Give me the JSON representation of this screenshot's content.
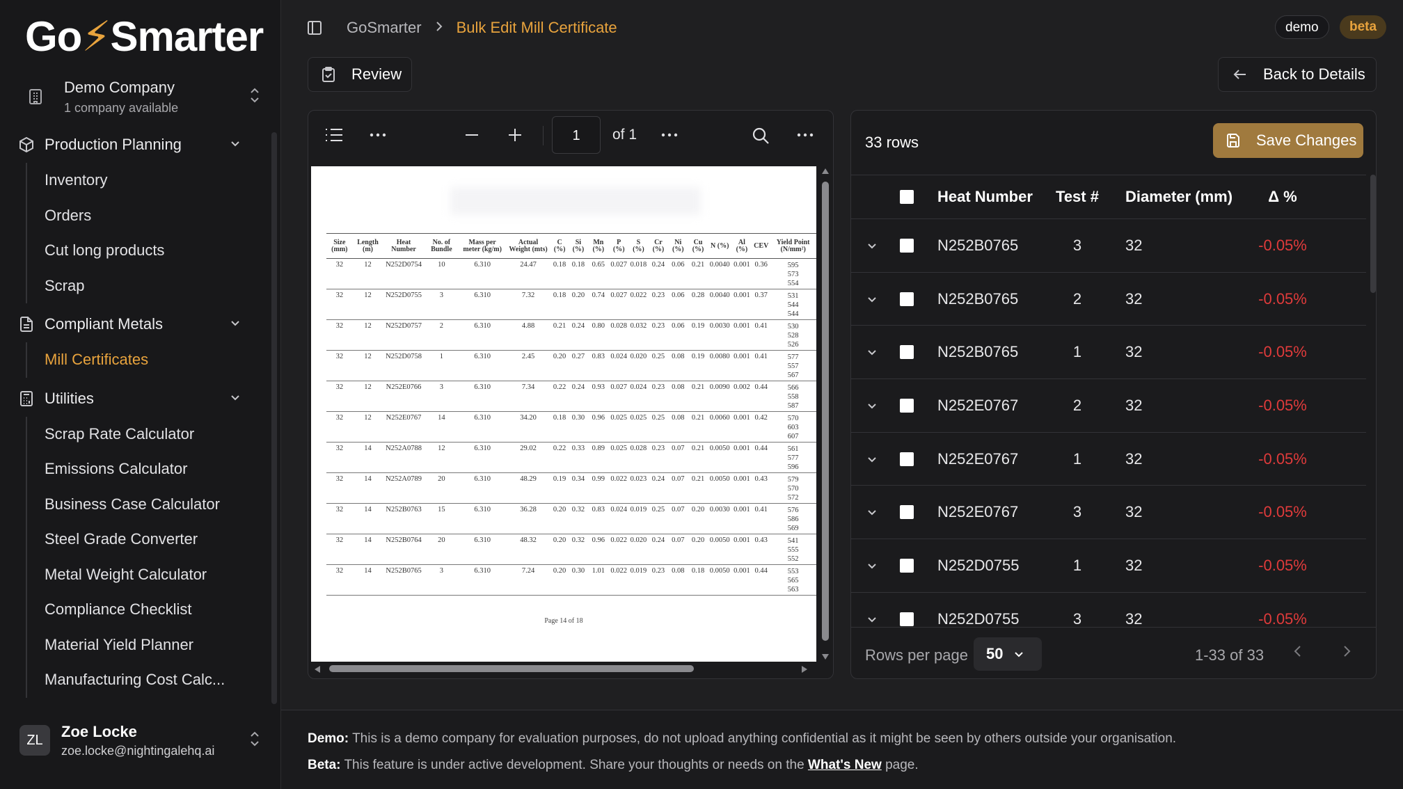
{
  "app": {
    "logo_text_a": "Go",
    "logo_text_b": "Smarter",
    "logo_full": "GoSmarter"
  },
  "company": {
    "name": "Demo Company",
    "sub": "1 company available"
  },
  "nav": [
    {
      "label": "Production Planning",
      "icon": "package-icon",
      "items": [
        "Inventory",
        "Orders",
        "Cut long products",
        "Scrap"
      ]
    },
    {
      "label": "Compliant Metals",
      "icon": "document-icon",
      "items": [
        "Mill Certificates"
      ]
    },
    {
      "label": "Utilities",
      "icon": "calculator-icon",
      "items": [
        "Scrap Rate Calculator",
        "Emissions Calculator",
        "Business Case Calculator",
        "Steel Grade Converter",
        "Metal Weight Calculator",
        "Compliance Checklist",
        "Material Yield Planner",
        "Manufacturing Cost Calc..."
      ]
    }
  ],
  "active_item": "Mill Certificates",
  "user": {
    "initials": "ZL",
    "name": "Zoe Locke",
    "email": "zoe.locke@nightingalehq.ai"
  },
  "breadcrumb": {
    "root": "GoSmarter",
    "current": "Bulk Edit Mill Certificate"
  },
  "badges": {
    "demo": "demo",
    "beta": "beta"
  },
  "buttons": {
    "review": "Review",
    "back": "Back to Details",
    "save": "Save Changes"
  },
  "viewer": {
    "page": "1",
    "of_pages": "of 1",
    "footer": "Page 14 of 18"
  },
  "certificate": {
    "headers": [
      "Size (mm)",
      "Length (m)",
      "Heat Number",
      "No. of Bundle",
      "Mass per meter (kg/m)",
      "Actual Weight (mts)",
      "C (%)",
      "Si (%)",
      "Mn (%)",
      "P (%)",
      "S (%)",
      "Cr (%)",
      "Ni (%)",
      "Cu (%)",
      "N (%)",
      "Al (%)",
      "CEV",
      "Yield Point (N/mm²)"
    ],
    "rows": [
      [
        "32",
        "12",
        "N252D0754",
        "10",
        "6.310",
        "24.47",
        "0.18",
        "0.18",
        "0.65",
        "0.027",
        "0.018",
        "0.24",
        "0.06",
        "0.21",
        "0.0040",
        "0.001",
        "0.36",
        "595\n573\n554"
      ],
      [
        "32",
        "12",
        "N252D0755",
        "3",
        "6.310",
        "7.32",
        "0.18",
        "0.20",
        "0.74",
        "0.027",
        "0.022",
        "0.23",
        "0.06",
        "0.28",
        "0.0040",
        "0.001",
        "0.37",
        "531\n544\n544"
      ],
      [
        "32",
        "12",
        "N252D0757",
        "2",
        "6.310",
        "4.88",
        "0.21",
        "0.24",
        "0.80",
        "0.028",
        "0.032",
        "0.23",
        "0.06",
        "0.19",
        "0.0030",
        "0.001",
        "0.41",
        "530\n528\n526"
      ],
      [
        "32",
        "12",
        "N252D0758",
        "1",
        "6.310",
        "2.45",
        "0.20",
        "0.27",
        "0.83",
        "0.024",
        "0.020",
        "0.25",
        "0.08",
        "0.19",
        "0.0080",
        "0.001",
        "0.41",
        "577\n557\n567"
      ],
      [
        "32",
        "12",
        "N252E0766",
        "3",
        "6.310",
        "7.34",
        "0.22",
        "0.24",
        "0.93",
        "0.027",
        "0.024",
        "0.23",
        "0.08",
        "0.21",
        "0.0090",
        "0.002",
        "0.44",
        "566\n558\n587"
      ],
      [
        "32",
        "12",
        "N252E0767",
        "14",
        "6.310",
        "34.20",
        "0.18",
        "0.30",
        "0.96",
        "0.025",
        "0.025",
        "0.25",
        "0.08",
        "0.21",
        "0.0060",
        "0.001",
        "0.42",
        "570\n603\n607"
      ],
      [
        "32",
        "14",
        "N252A0788",
        "12",
        "6.310",
        "29.02",
        "0.22",
        "0.33",
        "0.89",
        "0.025",
        "0.028",
        "0.23",
        "0.07",
        "0.21",
        "0.0050",
        "0.001",
        "0.44",
        "561\n577\n596"
      ],
      [
        "32",
        "14",
        "N252A0789",
        "20",
        "6.310",
        "48.29",
        "0.19",
        "0.34",
        "0.99",
        "0.022",
        "0.023",
        "0.24",
        "0.07",
        "0.21",
        "0.0050",
        "0.001",
        "0.43",
        "579\n570\n572"
      ],
      [
        "32",
        "14",
        "N252B0763",
        "15",
        "6.310",
        "36.28",
        "0.20",
        "0.32",
        "0.83",
        "0.024",
        "0.019",
        "0.25",
        "0.07",
        "0.20",
        "0.0030",
        "0.001",
        "0.41",
        "576\n586\n569"
      ],
      [
        "32",
        "14",
        "N252B0764",
        "20",
        "6.310",
        "48.32",
        "0.20",
        "0.32",
        "0.96",
        "0.022",
        "0.020",
        "0.24",
        "0.07",
        "0.20",
        "0.0050",
        "0.001",
        "0.43",
        "541\n555\n552"
      ],
      [
        "32",
        "14",
        "N252B0765",
        "3",
        "6.310",
        "7.24",
        "0.20",
        "0.30",
        "1.01",
        "0.022",
        "0.019",
        "0.23",
        "0.08",
        "0.18",
        "0.0050",
        "0.001",
        "0.44",
        "553\n565\n563"
      ]
    ]
  },
  "grid": {
    "row_count": "33 rows",
    "headers": {
      "heat": "Heat Number",
      "test": "Test #",
      "diameter": "Diameter (mm)",
      "delta": "Δ %"
    },
    "rows": [
      {
        "heat": "N252B0765",
        "test": "3",
        "diameter": "32",
        "delta": "-0.05%"
      },
      {
        "heat": "N252B0765",
        "test": "2",
        "diameter": "32",
        "delta": "-0.05%"
      },
      {
        "heat": "N252B0765",
        "test": "1",
        "diameter": "32",
        "delta": "-0.05%"
      },
      {
        "heat": "N252E0767",
        "test": "2",
        "diameter": "32",
        "delta": "-0.05%"
      },
      {
        "heat": "N252E0767",
        "test": "1",
        "diameter": "32",
        "delta": "-0.05%"
      },
      {
        "heat": "N252E0767",
        "test": "3",
        "diameter": "32",
        "delta": "-0.05%"
      },
      {
        "heat": "N252D0755",
        "test": "1",
        "diameter": "32",
        "delta": "-0.05%"
      },
      {
        "heat": "N252D0755",
        "test": "3",
        "diameter": "32",
        "delta": "-0.05%"
      }
    ],
    "rows_per_page_label": "Rows per page",
    "rows_per_page": "50",
    "range": "1-33 of 33"
  },
  "footer": {
    "demo_label": "Demo:",
    "demo_text": "This is a demo company for evaluation purposes, do not upload anything confidential as it might be seen by others outside your organisation.",
    "beta_label": "Beta:",
    "beta_text_a": "This feature is under active development. Share your thoughts or needs on the",
    "beta_link": "What's New",
    "beta_text_b": "page."
  },
  "colors": {
    "accent": "#e8a33d",
    "negative": "#e03b3b",
    "save_button": "#a07a3e"
  }
}
